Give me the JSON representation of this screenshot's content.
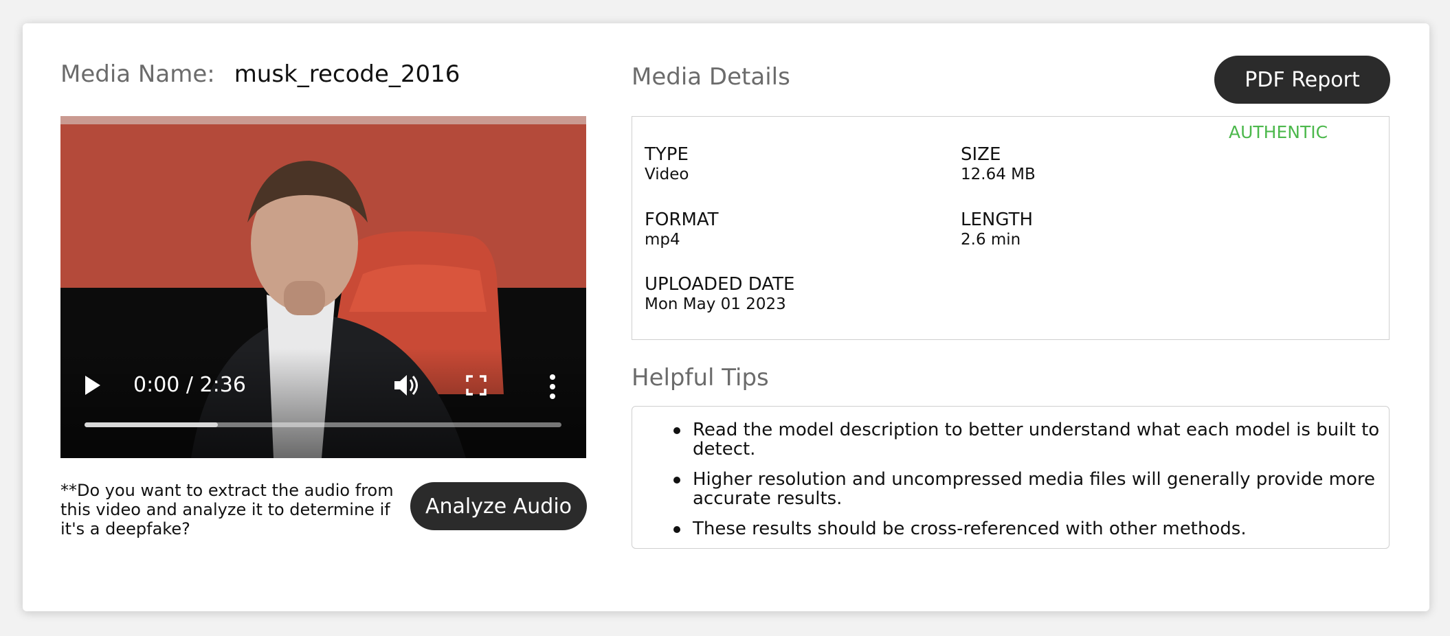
{
  "media": {
    "name_label": "Media Name:",
    "name_value": "musk_recode_2016"
  },
  "video": {
    "time": "0:00 / 2:36",
    "progress_fraction": 0.28
  },
  "audio": {
    "question": "**Do you want to extract the audio from this video and analyze it to determine if it's a deepfake?",
    "analyze_label": "Analyze Audio"
  },
  "details": {
    "title": "Media Details",
    "pdf_label": "PDF Report",
    "verdict": "AUTHENTIC",
    "verdict_color": "#4cb84c",
    "type_label": "TYPE",
    "type_value": "Video",
    "size_label": "SIZE",
    "size_value": "12.64 MB",
    "format_label": "FORMAT",
    "format_value": "mp4",
    "length_label": "LENGTH",
    "length_value": "2.6 min",
    "uploaded_label": "UPLOADED DATE",
    "uploaded_value": "Mon May 01 2023"
  },
  "tips": {
    "title": "Helpful Tips",
    "items": [
      "Read the model description to better understand what each model is built to detect.",
      "Higher resolution and uncompressed media files will generally provide more accurate results.",
      "These results should be cross-referenced with other methods."
    ]
  },
  "icons": {
    "play": "play-icon",
    "volume": "volume-icon",
    "fullscreen": "fullscreen-icon",
    "more": "more-vertical-icon"
  }
}
